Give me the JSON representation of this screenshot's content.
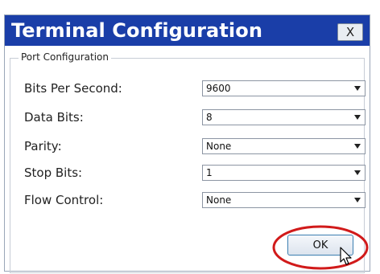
{
  "dialog": {
    "title": "Terminal Configuration",
    "close_label": "X",
    "group_label": "Port Configuration"
  },
  "fields": [
    {
      "label": "Bits Per Second:",
      "value": "9600"
    },
    {
      "label": "Data Bits:",
      "value": "8"
    },
    {
      "label": "Parity:",
      "value": "None"
    },
    {
      "label": "Stop Bits:",
      "value": "1"
    },
    {
      "label": "Flow Control:",
      "value": "None"
    }
  ],
  "ok_label": "OK",
  "colors": {
    "titlebar": "#1a3ea8",
    "highlight_circle": "#d11a1a"
  }
}
